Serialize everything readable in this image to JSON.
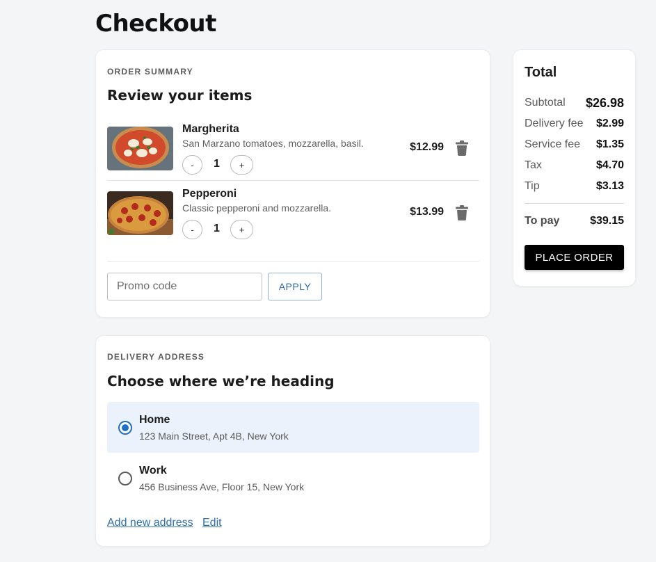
{
  "page": {
    "title": "Checkout"
  },
  "summary": {
    "eyebrow": "ORDER SUMMARY",
    "heading": "Review your items",
    "items": [
      {
        "name": "Margherita",
        "description": "San Marzano tomatoes, mozzarella, basil.",
        "quantity": "1",
        "price": "$12.99",
        "minus": "-",
        "plus": "+",
        "image": "margherita-pizza-photo"
      },
      {
        "name": "Pepperoni",
        "description": "Classic pepperoni and mozzarella.",
        "quantity": "1",
        "price": "$13.99",
        "minus": "-",
        "plus": "+",
        "image": "pepperoni-pizza-photo"
      }
    ],
    "promo": {
      "placeholder": "Promo code",
      "value": "",
      "apply_label": "APPLY"
    }
  },
  "address": {
    "eyebrow": "DELIVERY ADDRESS",
    "heading": "Choose where we’re heading",
    "options": [
      {
        "name": "Home",
        "line": "123 Main Street, Apt 4B, New York",
        "selected": true
      },
      {
        "name": "Work",
        "line": "456 Business Ave, Floor 15, New York",
        "selected": false
      }
    ],
    "add_link": "Add new address",
    "edit_link": "Edit"
  },
  "total": {
    "title": "Total",
    "rows": [
      {
        "label": "Subtotal",
        "value": "$26.98"
      },
      {
        "label": "Delivery fee",
        "value": "$2.99"
      },
      {
        "label": "Service fee",
        "value": "$1.35"
      },
      {
        "label": "Tax",
        "value": "$4.70"
      },
      {
        "label": "Tip",
        "value": "$3.13"
      }
    ],
    "to_pay_label": "To pay",
    "to_pay_value": "$39.15",
    "place_order_label": "PLACE ORDER"
  },
  "icons": {
    "delete": "trash-icon"
  },
  "colors": {
    "accent": "#1e6fc6",
    "selected_bg": "#ebf2fb",
    "primary_button": "#000000",
    "link": "#2d6fb0"
  }
}
